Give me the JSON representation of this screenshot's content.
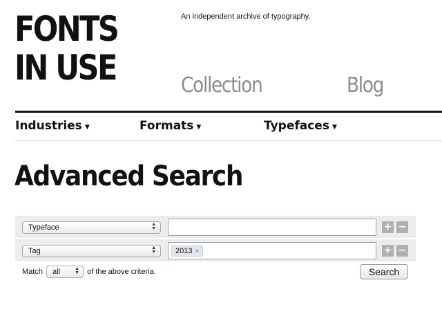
{
  "header": {
    "logo_line1": "FONTS",
    "logo_line2": "IN USE",
    "tagline": "An independent archive of typography.",
    "links": {
      "collection": "Collection",
      "blog": "Blog"
    }
  },
  "nav": {
    "items": [
      {
        "label": "Industries"
      },
      {
        "label": "Formats"
      },
      {
        "label": "Typefaces"
      }
    ]
  },
  "page": {
    "title": "Advanced Search"
  },
  "criteria": [
    {
      "field": "Typeface",
      "value": "",
      "tokens": []
    },
    {
      "field": "Tag",
      "value": "",
      "tokens": [
        "2013"
      ]
    }
  ],
  "buttons": {
    "plus": "+",
    "minus": "−",
    "token_remove": "×",
    "search": "Search"
  },
  "match": {
    "prefix": "Match",
    "selected": "all",
    "suffix": "of the above criteria."
  },
  "icons": {
    "caret": "caret-down-icon",
    "select_arrows": "select-arrows-icon"
  },
  "colors": {
    "link_gray": "#8a8a8a",
    "panel_gray": "#ececec",
    "button_gray": "#b0b0b0"
  }
}
